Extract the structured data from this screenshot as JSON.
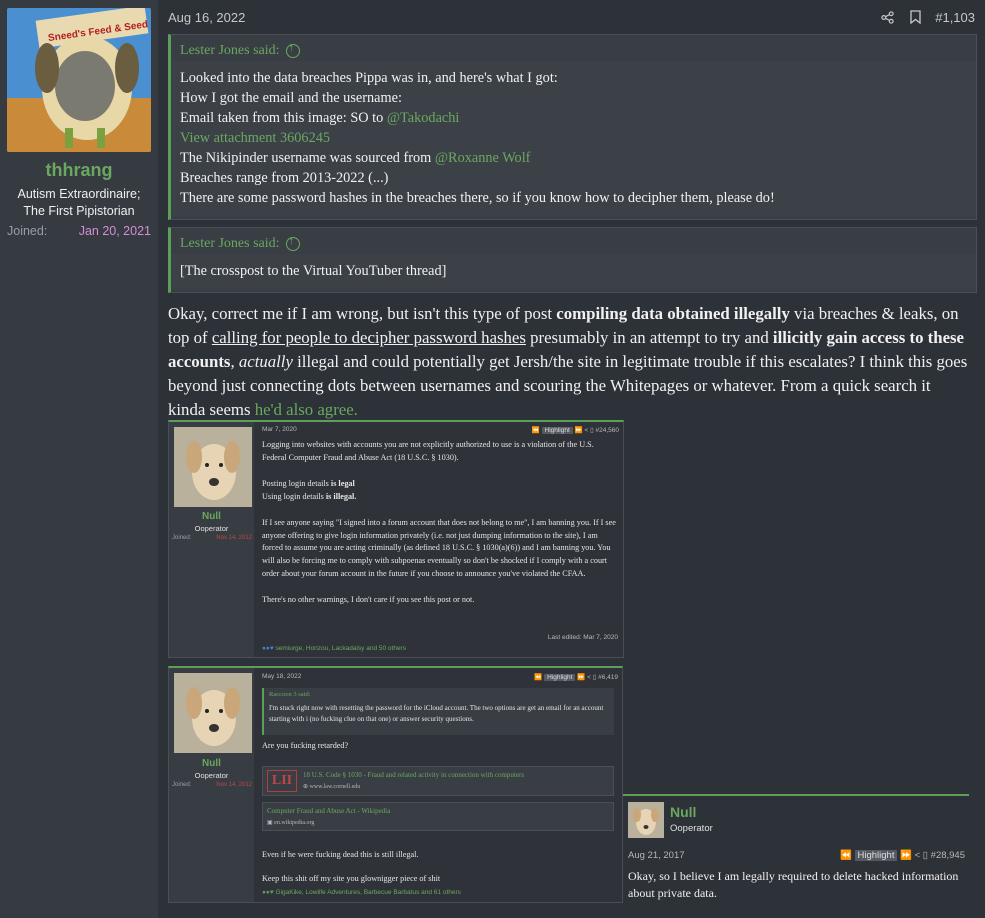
{
  "user": {
    "name": "thhrang",
    "title_line1": "Autism Extraordinaire;",
    "title_line2": "The First Pipistorian",
    "joined_label": "Joined:",
    "joined_date": "Jan 20, 2021",
    "avatar_sign": "Sneed's Feed & Seed"
  },
  "post": {
    "date": "Aug 16, 2022",
    "number": "#1,103",
    "quote1": {
      "author": "Lester Jones said:",
      "line1": "Looked into the data breaches Pippa was in, and here's what I got:",
      "line2": "How I got the email and the username:",
      "line3_prefix": "Email taken from this image: SO to ",
      "line3_mention": "@Takodachi",
      "attachment": "View attachment 3606245",
      "line5_prefix": "The Nikipinder username was sourced from ",
      "line5_mention": "@Roxanne Wolf",
      "line6": "Breaches range from 2013-2022 (...)",
      "line7": "There are some password hashes in the breaches there, so if you know how to decipher them, please do!"
    },
    "quote2": {
      "author": "Lester Jones said:",
      "body": "[The crosspost to the Virtual YouTuber thread]"
    },
    "body": {
      "t1": "Okay, correct me if I am wrong, but isn't this type of post ",
      "b1": "compiling data obtained illegally",
      "t2": " via breaches & leaks, on top of ",
      "u1": "calling for people to decipher password hashes",
      "t3": " presumably in an attempt to try and ",
      "b2": "illicitly gain access to these accounts",
      "t4": ", ",
      "i1": "actually",
      "t5": " illegal and could potentially get Jersh/the site in legitimate trouble if this escalates? I think this goes beyond just connecting dots between usernames and scouring the Whitepages or whatever. From a quick search it kinda seems ",
      "link": "he'd also agree."
    }
  },
  "shot1": {
    "name": "Null",
    "role": "Ooperator",
    "joined_label": "Joined:",
    "joined_date": "Nov 14, 2012",
    "date": "Mar 7, 2020",
    "highlight": "Highlight",
    "number": "#24,560",
    "p1": "Logging into websites with accounts you are not explicitly authorized to use is a violation of the U.S. Federal Computer Fraud and Abuse Act (18 U.S.C. § 1030).",
    "p2a": "Posting login details ",
    "p2b": "is legal",
    "p3a": "Using login details ",
    "p3b": "is illegal.",
    "p4": "If I see anyone saying \"I signed into a forum account that does not belong to me\", I am banning you. If I see anyone offering to give login information privately (i.e. not just dumping information to the site), I am forced to assume you are acting criminally (as defined 18 U.S.C. § 1030(a)(6)) and I am banning you. You will also be forcing me to comply with subpoenas eventually so don't be shocked if I comply with a court order about your forum account in the future if you choose to announce you've violated the CFAA.",
    "p5": "There's no other warnings, I don't care if you see this post or not.",
    "edited": "Last edited: Mar 7, 2020",
    "reactions": "semiurge, Honzou, Lackadaisy and 50 others"
  },
  "shot2": {
    "name": "Null",
    "role": "Ooperator",
    "joined_label": "Joined:",
    "joined_date": "Nov 14, 2012",
    "date": "May 18, 2022",
    "highlight": "Highlight",
    "number": "#6,419",
    "quote_author": "Raccoon 3 said:",
    "quote_body": "I'm stuck right now with resetting the password for the iCloud account. The two options are get an email for an account starting with i (no fucking clue on that one) or answer security questions.",
    "reply1": "Are you fucking retarded?",
    "lii_logo": "LII",
    "link1_title": "18 U.S. Code § 1030 - Fraud and related activity in connection with computers",
    "link1_url": "www.law.cornell.edu",
    "link2_title": "Computer Fraud and Abuse Act - Wikipedia",
    "link2_url": "en.wikipedia.org",
    "reply2": "Even if he were fucking dead this is still illegal.",
    "reply3": "Keep this shit off my site you glownigger piece of shit",
    "reactions": "GigaKike, Lowlife Adventures, Barbecue Barbatus and 61 others"
  },
  "shot3": {
    "name": "Null",
    "role": "Ooperator",
    "date": "Aug 21, 2017",
    "highlight": "Highlight",
    "number": "#28,945",
    "text": "Okay, so I believe I am legally required to delete hacked information about private data."
  }
}
